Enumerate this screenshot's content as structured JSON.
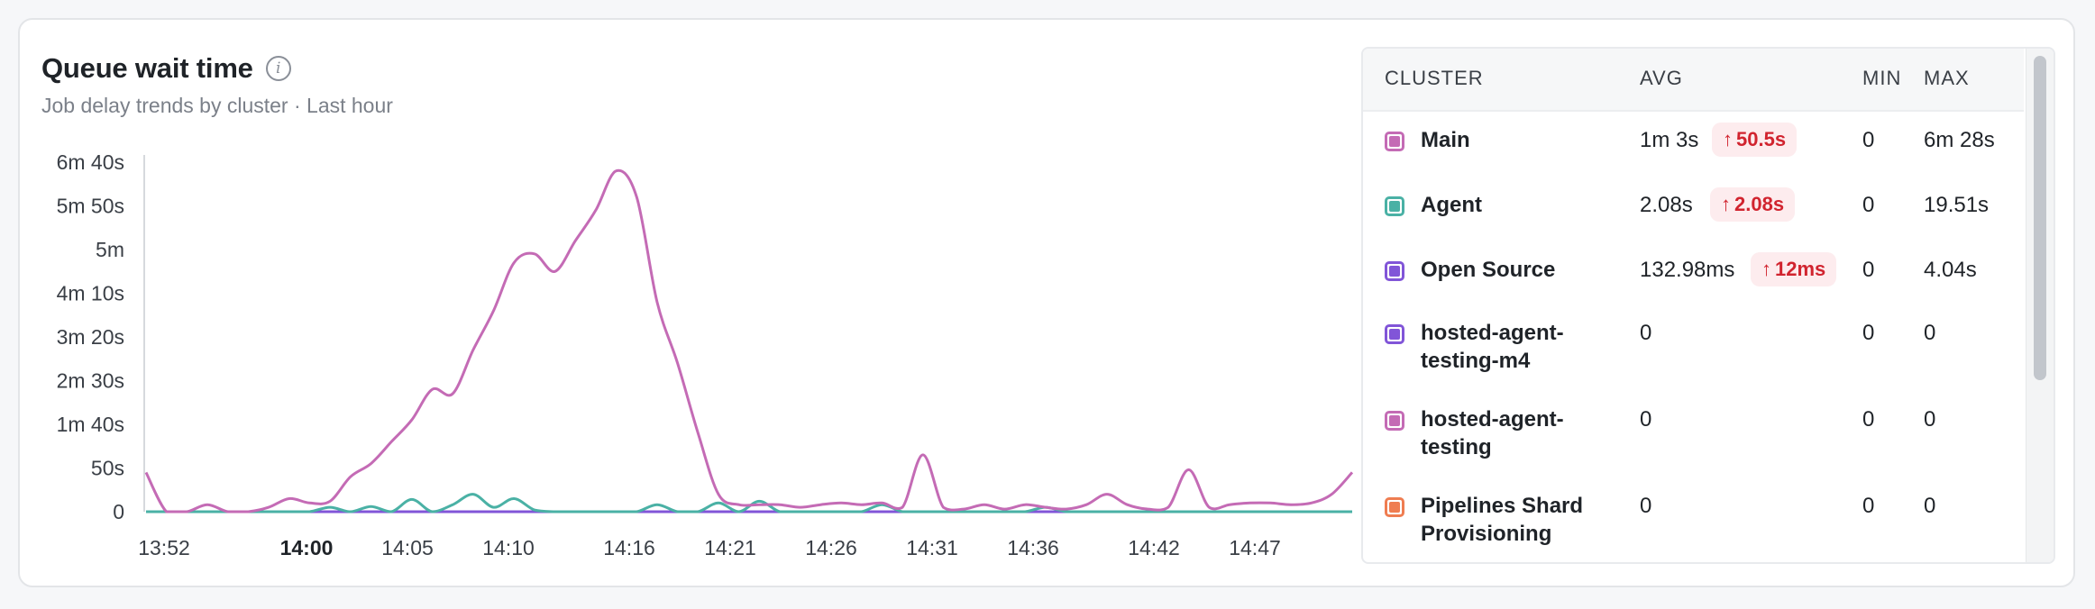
{
  "header": {
    "title": "Queue wait time",
    "subtitle": "Job delay trends by cluster · Last hour",
    "info_icon": "info-icon"
  },
  "chart_data": {
    "type": "line",
    "y_ticks": [
      "6m 40s",
      "5m 50s",
      "5m",
      "4m 10s",
      "3m 20s",
      "2m 30s",
      "1m 40s",
      "50s",
      "0"
    ],
    "y_tick_seconds": [
      400,
      350,
      300,
      250,
      200,
      150,
      100,
      50,
      0
    ],
    "ylim": [
      0,
      400
    ],
    "x_ticks": [
      {
        "label": "13:52",
        "bold": false
      },
      {
        "label": "14:00",
        "bold": true
      },
      {
        "label": "14:05",
        "bold": false
      },
      {
        "label": "14:10",
        "bold": false
      },
      {
        "label": "14:16",
        "bold": false
      },
      {
        "label": "14:21",
        "bold": false
      },
      {
        "label": "14:26",
        "bold": false
      },
      {
        "label": "14:31",
        "bold": false
      },
      {
        "label": "14:36",
        "bold": false
      },
      {
        "label": "14:42",
        "bold": false
      },
      {
        "label": "14:47",
        "bold": false
      }
    ],
    "series": [
      {
        "name": "Main",
        "color": "#c46bb5",
        "x": [
          0,
          1,
          2,
          3,
          4,
          5,
          6,
          7,
          8,
          9,
          10,
          11,
          12,
          13,
          14,
          15,
          16,
          17,
          18,
          19,
          20,
          21,
          22,
          23,
          24,
          25,
          26,
          27,
          28,
          29,
          30,
          31,
          32,
          33,
          34,
          35,
          36,
          37,
          38,
          39,
          40,
          41,
          42,
          43,
          44,
          45,
          46,
          47,
          48,
          49,
          50,
          51,
          52,
          53,
          54,
          55,
          56,
          57,
          58,
          59
        ],
        "values": [
          45,
          0,
          0,
          8,
          0,
          0,
          5,
          15,
          10,
          12,
          40,
          55,
          80,
          105,
          140,
          135,
          185,
          230,
          285,
          295,
          275,
          310,
          345,
          390,
          360,
          240,
          170,
          90,
          20,
          8,
          8,
          8,
          5,
          8,
          10,
          8,
          10,
          5,
          65,
          5,
          3,
          8,
          3,
          8,
          5,
          3,
          8,
          20,
          8,
          3,
          5,
          48,
          5,
          8,
          10,
          10,
          8,
          10,
          20,
          45
        ]
      },
      {
        "name": "Agent",
        "color": "#4ab1a5",
        "x": [
          0,
          1,
          2,
          3,
          4,
          5,
          6,
          7,
          8,
          9,
          10,
          11,
          12,
          13,
          14,
          15,
          16,
          17,
          18,
          19,
          20,
          21,
          22,
          23,
          24,
          25,
          26,
          27,
          28,
          29,
          30,
          31,
          32,
          33,
          34,
          35,
          36,
          37,
          38,
          39,
          40,
          41,
          42,
          43,
          44,
          45,
          46,
          47,
          48,
          49,
          50,
          51,
          52,
          53,
          54,
          55,
          56,
          57,
          58,
          59
        ],
        "values": [
          0,
          0,
          0,
          0,
          0,
          0,
          0,
          0,
          0,
          5,
          0,
          6,
          0,
          14,
          0,
          8,
          20,
          5,
          15,
          2,
          0,
          0,
          0,
          0,
          0,
          8,
          0,
          0,
          10,
          0,
          12,
          0,
          0,
          0,
          0,
          0,
          8,
          0,
          0,
          0,
          0,
          0,
          0,
          0,
          5,
          0,
          0,
          0,
          0,
          0,
          0,
          0,
          0,
          0,
          0,
          0,
          0,
          0,
          0,
          0
        ]
      },
      {
        "name": "Open Source",
        "color": "#8155d8",
        "x": [
          0,
          1,
          2,
          3,
          4,
          5,
          6,
          7,
          8,
          9,
          10,
          11,
          12,
          13,
          14,
          15,
          16,
          17,
          18,
          19,
          20,
          21,
          22,
          23,
          24,
          25,
          26,
          27,
          28,
          29,
          30,
          31,
          32,
          33,
          34,
          35,
          36,
          37,
          38,
          39,
          40,
          41,
          42,
          43,
          44,
          45,
          46,
          47,
          48,
          49,
          50,
          51,
          52,
          53,
          54,
          55,
          56,
          57,
          58,
          59
        ],
        "values": [
          0,
          0,
          0,
          0,
          0,
          0,
          0,
          0,
          0,
          0,
          0,
          0,
          0,
          0,
          0,
          0,
          0,
          0,
          0,
          0,
          0,
          0,
          0,
          0,
          0,
          0,
          0,
          0,
          0,
          0,
          0,
          0,
          0,
          0,
          0,
          0,
          0,
          0,
          0,
          0,
          0,
          0,
          0,
          0,
          0,
          0,
          0,
          0,
          0,
          0,
          0,
          0,
          0,
          0,
          0,
          0,
          0,
          0,
          0,
          0
        ]
      }
    ]
  },
  "table": {
    "headers": {
      "cluster": "CLUSTER",
      "avg": "AVG",
      "min": "MIN",
      "max": "MAX"
    },
    "rows": [
      {
        "name_line1": "Main",
        "name_line2": "",
        "color": "#c46bb5",
        "avg": "1m 3s",
        "badge": "50.5s",
        "min": "0",
        "max": "6m 28s"
      },
      {
        "name_line1": "Agent",
        "name_line2": "",
        "color": "#4ab1a5",
        "avg": "2.08s",
        "badge": "2.08s",
        "min": "0",
        "max": "19.51s"
      },
      {
        "name_line1": "Open Source",
        "name_line2": "",
        "color": "#8155d8",
        "avg": "132.98ms",
        "badge": "12ms",
        "min": "0",
        "max": "4.04s"
      },
      {
        "name_line1": "hosted-agent-",
        "name_line2": "testing-m4",
        "color": "#8155d8",
        "avg": "0",
        "badge": "",
        "min": "0",
        "max": "0"
      },
      {
        "name_line1": "hosted-agent-",
        "name_line2": "testing",
        "color": "#c46bb5",
        "avg": "0",
        "badge": "",
        "min": "0",
        "max": "0"
      },
      {
        "name_line1": "Pipelines Shard",
        "name_line2": "Provisioning",
        "color": "#ef7d51",
        "avg": "0",
        "badge": "",
        "min": "0",
        "max": "0"
      }
    ],
    "badge_arrow": "↑"
  }
}
